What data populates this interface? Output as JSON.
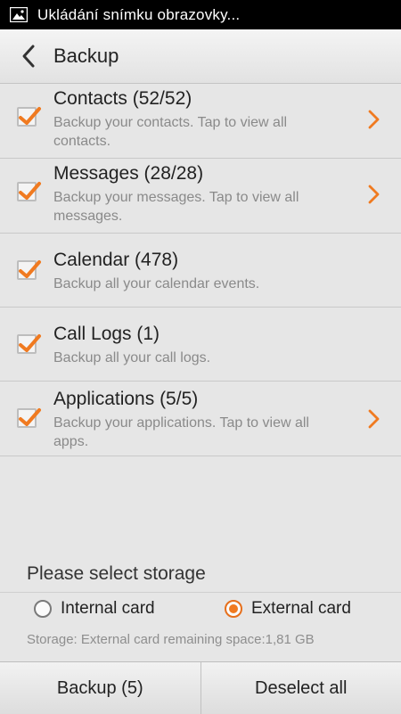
{
  "status_bar": {
    "text": "Ukládání snímku obrazovky..."
  },
  "header": {
    "title": "Backup"
  },
  "items": [
    {
      "title": "Contacts (52/52)",
      "description": "Backup your contacts. Tap to view all contacts.",
      "checked": true,
      "has_chevron": true
    },
    {
      "title": "Messages (28/28)",
      "description": "Backup your messages. Tap to view all messages.",
      "checked": true,
      "has_chevron": true
    },
    {
      "title": "Calendar (478)",
      "description": "Backup all your calendar events.",
      "checked": true,
      "has_chevron": false
    },
    {
      "title": "Call Logs (1)",
      "description": "Backup all your call logs.",
      "checked": true,
      "has_chevron": false
    },
    {
      "title": "Applications (5/5)",
      "description": "Backup your applications. Tap to view all apps.",
      "checked": true,
      "has_chevron": true
    }
  ],
  "storage": {
    "label": "Please select storage",
    "options": [
      {
        "label": "Internal card",
        "selected": false
      },
      {
        "label": "External card",
        "selected": true
      }
    ],
    "info": "Storage: External card remaining space:1,81 GB"
  },
  "bottom_bar": {
    "backup_label": "Backup (5)",
    "deselect_label": "Deselect all"
  },
  "colors": {
    "accent": "#f07a20",
    "text": "#222222",
    "secondary_text": "#8a8a8a"
  },
  "icons": {
    "status": "image-icon",
    "back": "chevron-left-icon",
    "check": "checkmark-icon",
    "row_arrow": "chevron-right-icon"
  }
}
